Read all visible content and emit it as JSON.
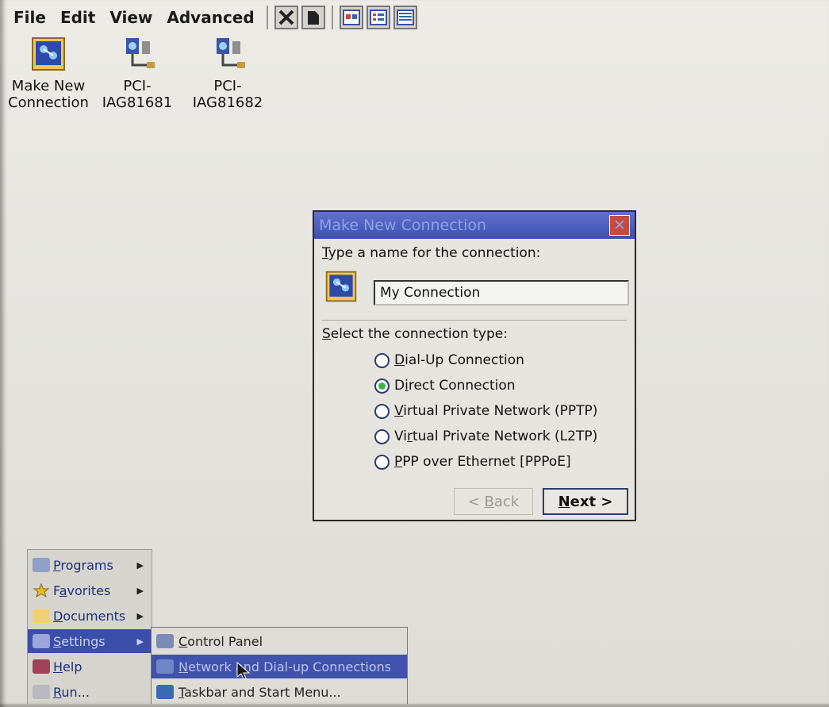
{
  "menubar": {
    "items": [
      {
        "label": "File"
      },
      {
        "label": "Edit"
      },
      {
        "label": "View"
      },
      {
        "label": "Advanced"
      }
    ],
    "toolbar_icons": [
      "delete-icon",
      "properties-icon",
      "large-icons-view-icon",
      "small-icons-view-icon",
      "details-view-icon"
    ]
  },
  "desktop_icons": [
    {
      "label_line1": "Make New",
      "label_line2": "Connection",
      "icon": "make-new-connection-icon"
    },
    {
      "label_line1": "PCI-",
      "label_line2": "IAG81681",
      "icon": "network-connection-icon"
    },
    {
      "label_line1": "PCI-",
      "label_line2": "IAG81682",
      "icon": "network-connection-icon"
    }
  ],
  "dialog": {
    "title": "Make New Connection",
    "name_prompt_mnemonic": "T",
    "name_prompt_rest": "ype a name for the connection:",
    "name_value": "My Connection",
    "type_prompt_mnemonic": "S",
    "type_prompt_rest": "elect the connection type:",
    "options": [
      {
        "mn": "D",
        "rest": "ial-Up Connection",
        "selected": false
      },
      {
        "mn": "",
        "pre": "D",
        "mid": "i",
        "rest": "rect Connection",
        "selected": true
      },
      {
        "mn": "V",
        "rest": "irtual Private Network (PPTP)",
        "selected": false
      },
      {
        "pre": "Vi",
        "mid": "r",
        "rest": "tual Private Network (L2TP)",
        "selected": false
      },
      {
        "mn": "P",
        "rest": "PP over Ethernet [PPPoE]",
        "selected": false
      }
    ],
    "back_prefix": "< ",
    "back_mn": "B",
    "back_rest": "ack",
    "next_mn": "N",
    "next_rest": "ext >"
  },
  "start_menu": {
    "items": [
      {
        "mn": "P",
        "rest": "rograms"
      },
      {
        "pre": "F",
        "mn": "a",
        "rest": "vorites"
      },
      {
        "mn": "D",
        "rest": "ocuments"
      },
      {
        "mn": "S",
        "rest": "ettings"
      },
      {
        "mn": "H",
        "rest": "elp"
      },
      {
        "mn": "R",
        "rest": "un..."
      }
    ]
  },
  "settings_submenu": {
    "items": [
      {
        "mn": "C",
        "rest": "ontrol Panel"
      },
      {
        "mn": "N",
        "rest": "etwork and Dial-up Connections"
      },
      {
        "mn": "T",
        "rest": "askbar and Start Menu..."
      }
    ]
  },
  "colors": {
    "title_bar": "#3e4fb4",
    "highlight": "#3b4ea8",
    "selected_radio": "#3fb34a",
    "close_button": "#c84a3c"
  }
}
